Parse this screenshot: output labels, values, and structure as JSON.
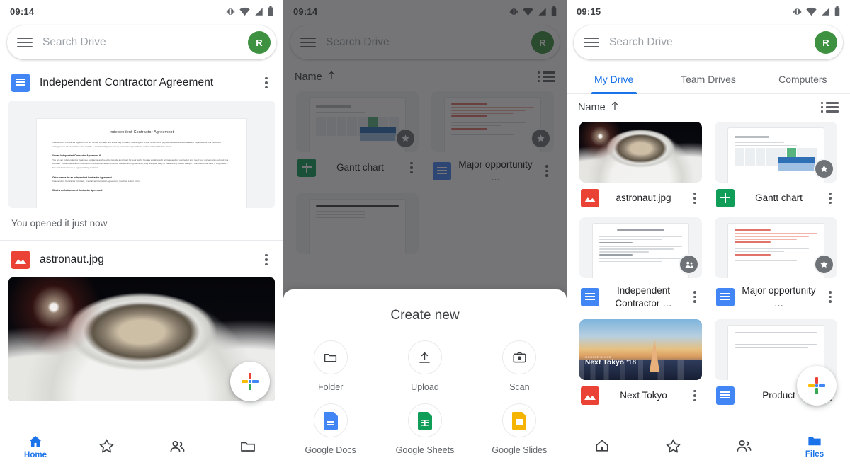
{
  "panels": [
    {
      "id": "home-feed",
      "status": {
        "time": "09:14",
        "icons": [
          "ringer-vibrate-icon",
          "wifi-icon",
          "signal-icon",
          "battery-icon"
        ]
      },
      "search": {
        "placeholder": "Search Drive",
        "menu_icon": "hamburger-menu-icon",
        "avatar_initial": "R"
      },
      "feed": [
        {
          "icon": "google-docs-icon",
          "title": "Independent Contractor Agreement",
          "menu_icon": "kebab-menu-icon",
          "preview": {
            "title": "Independent Contractor Agreement",
            "paragraph": "Independent Contractor Agreements are simple to make and are a way of clearly outlining the scope of the work, payment schedules and deadline expectations of a freelance arrangement. Our templates also include a confidentiality agreement, insurance expectations and an indemnification clause.",
            "heading1": "Use an Independent Contractor Agreement if:",
            "body1": "You are an independent or freelance contractor and need to provide a contract for your work. You are working with an independent contractor and need your agreements outlined in a contract. While Independent Contractor Contracts include numerous clauses and agreements, they are quite easy to make using Rocket Lawyer's document interview. It only takes a few minutes to create a legal, working contract.",
            "heading2": "Other names for an Independent Contractor Agreement",
            "body2": "Independent Contractor Contract, Freelancer Contractor Agreement, Contract Labor Form",
            "heading3": "What is an Independent Contractor Agreement?"
          },
          "meta": "You opened it just now"
        },
        {
          "icon": "image-file-icon",
          "title": "astronaut.jpg",
          "menu_icon": "kebab-menu-icon",
          "preview_alt": "astronaut spacewalk photo"
        }
      ],
      "fab": {
        "icon": "google-plus-icon",
        "label": "Create new"
      },
      "bottom_nav": {
        "items": [
          {
            "icon": "home-icon",
            "label": "Home",
            "active": true
          },
          {
            "icon": "star-icon",
            "label": "",
            "active": false
          },
          {
            "icon": "people-icon",
            "label": "",
            "active": false
          },
          {
            "icon": "folder-icon",
            "label": "",
            "active": false
          }
        ]
      }
    },
    {
      "id": "create-new-sheet",
      "status": {
        "time": "09:14",
        "icons": [
          "ringer-vibrate-icon",
          "wifi-icon",
          "signal-icon",
          "battery-icon"
        ]
      },
      "search": {
        "placeholder": "Search Drive",
        "menu_icon": "hamburger-menu-icon",
        "avatar_initial": "R"
      },
      "sort": {
        "label": "Name",
        "direction_icon": "arrow-up-icon",
        "view_toggle_icon": "list-view-icon"
      },
      "files": [
        {
          "icon": "google-sheets-icon",
          "name": "Gantt chart",
          "badge": "starred-badge",
          "thumb": "gantt-chart-thumbnail",
          "menu_icon": "kebab-menu-icon"
        },
        {
          "icon": "google-docs-icon",
          "name": "Major opportunity …",
          "badge": "starred-badge",
          "thumb": "red-text-document-thumbnail",
          "menu_icon": "kebab-menu-icon"
        },
        {
          "icon": "google-docs-icon",
          "name": "",
          "badge": "",
          "thumb": "plain-document-thumbnail",
          "menu_icon": "kebab-menu-icon"
        }
      ],
      "sheet": {
        "title": "Create new",
        "options": [
          {
            "icon": "folder-outline-icon",
            "label": "Folder"
          },
          {
            "icon": "upload-icon",
            "label": "Upload"
          },
          {
            "icon": "camera-scan-icon",
            "label": "Scan"
          },
          {
            "icon": "google-docs-icon",
            "label": "Google Docs"
          },
          {
            "icon": "google-sheets-icon",
            "label": "Google Sheets"
          },
          {
            "icon": "google-slides-icon",
            "label": "Google Slides"
          }
        ]
      }
    },
    {
      "id": "my-drive-files",
      "status": {
        "time": "09:15",
        "icons": [
          "ringer-vibrate-icon",
          "wifi-icon",
          "signal-icon",
          "battery-icon"
        ]
      },
      "search": {
        "placeholder": "Search Drive",
        "menu_icon": "hamburger-menu-icon",
        "avatar_initial": "R"
      },
      "tabs": [
        {
          "label": "My Drive",
          "active": true
        },
        {
          "label": "Team Drives",
          "active": false
        },
        {
          "label": "Computers",
          "active": false
        }
      ],
      "sort": {
        "label": "Name",
        "direction_icon": "arrow-up-icon",
        "view_toggle_icon": "list-view-icon"
      },
      "files": [
        {
          "icon": "image-file-icon",
          "name": "astronaut.jpg",
          "badge": "",
          "thumb": "astronaut-photo-thumbnail",
          "menu_icon": "kebab-menu-icon"
        },
        {
          "icon": "google-sheets-icon",
          "name": "Gantt chart",
          "badge": "starred-badge",
          "thumb": "gantt-chart-thumbnail",
          "menu_icon": "kebab-menu-icon"
        },
        {
          "icon": "google-docs-icon",
          "name": "Independent Contractor …",
          "badge": "shared-badge",
          "thumb": "contract-document-thumbnail",
          "menu_icon": "kebab-menu-icon"
        },
        {
          "icon": "google-docs-icon",
          "name": "Major opportunity …",
          "badge": "starred-badge",
          "thumb": "red-text-document-thumbnail",
          "menu_icon": "kebab-menu-icon"
        },
        {
          "icon": "image-file-icon",
          "name": "Next Tokyo",
          "badge": "",
          "thumb": "next-tokyo-photo-thumbnail",
          "menu_icon": "kebab-menu-icon"
        },
        {
          "icon": "google-docs-icon",
          "name": "Product",
          "badge": "",
          "thumb": "japanese-document-thumbnail",
          "menu_icon": "kebab-menu-icon"
        }
      ],
      "tokyo_caption": {
        "small": "GOOGLE CLOUD",
        "big": "Next Tokyo '18"
      },
      "gantt_caption": "GANTT CHART TEMPLATE",
      "fab": {
        "icon": "google-plus-icon",
        "label": "Create new"
      },
      "bottom_nav": {
        "items": [
          {
            "icon": "home-icon",
            "label": "",
            "active": false
          },
          {
            "icon": "star-icon",
            "label": "",
            "active": false
          },
          {
            "icon": "people-icon",
            "label": "",
            "active": false
          },
          {
            "icon": "folder-icon",
            "label": "Files",
            "active": true
          }
        ]
      }
    }
  ],
  "colors": {
    "accent_blue": "#1a73e8",
    "docs_blue": "#4285f4",
    "sheets_green": "#0f9d58",
    "slides_yellow": "#f4b400",
    "image_red": "#ea4335",
    "avatar_green": "#3d9140",
    "scrim": "rgba(32,33,36,0.62)"
  }
}
